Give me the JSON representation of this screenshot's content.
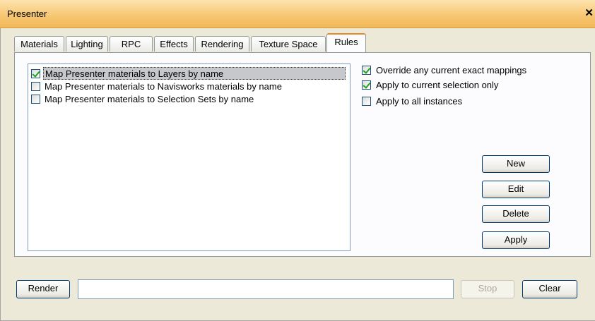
{
  "window": {
    "title": "Presenter",
    "close_glyph": "✕"
  },
  "tabs": [
    {
      "label": "Materials"
    },
    {
      "label": "Lighting"
    },
    {
      "label": "RPC"
    },
    {
      "label": "Effects"
    },
    {
      "label": "Rendering"
    },
    {
      "label": "Texture Space"
    },
    {
      "label": "Rules",
      "active": true
    }
  ],
  "rules": [
    {
      "label": "Map Presenter materials to Layers by name",
      "checked": true,
      "selected": true
    },
    {
      "label": "Map Presenter materials to Navisworks materials by name",
      "checked": false
    },
    {
      "label": "Map Presenter materials to Selection Sets by name",
      "checked": false
    }
  ],
  "options": [
    {
      "label": "Override any current exact mappings",
      "checked": true
    },
    {
      "label": "Apply to current selection only",
      "checked": true
    },
    {
      "label": "Apply to all instances",
      "checked": false
    }
  ],
  "buttons": {
    "new": "New",
    "edit": "Edit",
    "delete": "Delete",
    "apply": "Apply"
  },
  "bottom": {
    "render": "Render",
    "progress_text": "",
    "stop": "Stop",
    "clear": "Clear"
  }
}
